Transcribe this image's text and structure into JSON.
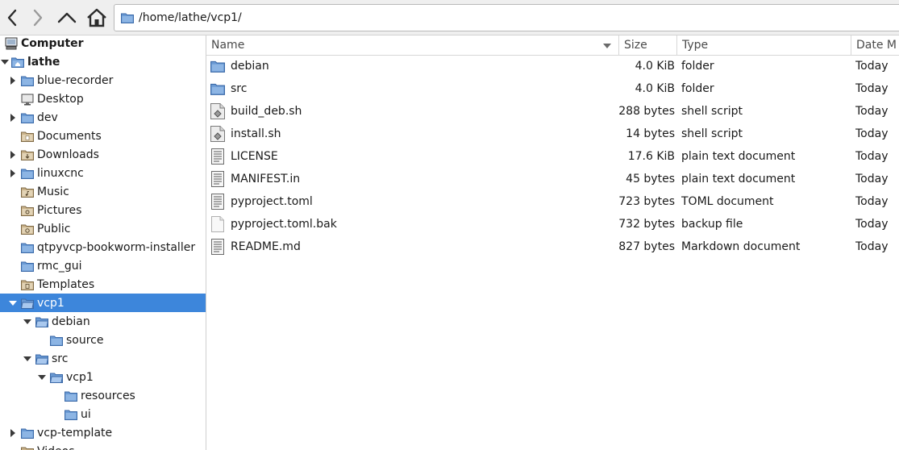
{
  "toolbar": {
    "location": "/home/lathe/vcp1/"
  },
  "sidebar": {
    "items": [
      {
        "label": "Computer",
        "icon": "computer-icon",
        "depth": 0,
        "expander": "none",
        "bold": true
      },
      {
        "label": "lathe",
        "icon": "home-folder-icon",
        "depth": 0,
        "expander": "open",
        "bold": true
      },
      {
        "label": "blue-recorder",
        "icon": "folder-icon",
        "depth": 1,
        "expander": "closed"
      },
      {
        "label": "Desktop",
        "icon": "desktop-icon",
        "depth": 1,
        "expander": "none"
      },
      {
        "label": "dev",
        "icon": "folder-icon",
        "depth": 1,
        "expander": "closed"
      },
      {
        "label": "Documents",
        "icon": "documents-folder-icon",
        "depth": 1,
        "expander": "none"
      },
      {
        "label": "Downloads",
        "icon": "downloads-folder-icon",
        "depth": 1,
        "expander": "closed"
      },
      {
        "label": "linuxcnc",
        "icon": "folder-icon",
        "depth": 1,
        "expander": "closed"
      },
      {
        "label": "Music",
        "icon": "music-folder-icon",
        "depth": 1,
        "expander": "none"
      },
      {
        "label": "Pictures",
        "icon": "pictures-folder-icon",
        "depth": 1,
        "expander": "none"
      },
      {
        "label": "Public",
        "icon": "public-folder-icon",
        "depth": 1,
        "expander": "none"
      },
      {
        "label": "qtpyvcp-bookworm-installer",
        "icon": "folder-icon",
        "depth": 1,
        "expander": "none"
      },
      {
        "label": "rmc_gui",
        "icon": "folder-icon",
        "depth": 1,
        "expander": "none"
      },
      {
        "label": "Templates",
        "icon": "templates-folder-icon",
        "depth": 1,
        "expander": "none"
      },
      {
        "label": "vcp1",
        "icon": "folder-open-icon",
        "depth": 1,
        "expander": "open",
        "selected": true
      },
      {
        "label": "debian",
        "icon": "folder-open-icon",
        "depth": 2,
        "expander": "open"
      },
      {
        "label": "source",
        "icon": "folder-icon",
        "depth": 3,
        "expander": "none"
      },
      {
        "label": "src",
        "icon": "folder-open-icon",
        "depth": 2,
        "expander": "open"
      },
      {
        "label": "vcp1",
        "icon": "folder-open-icon",
        "depth": 3,
        "expander": "open"
      },
      {
        "label": "resources",
        "icon": "folder-icon",
        "depth": 4,
        "expander": "none"
      },
      {
        "label": "ui",
        "icon": "folder-icon",
        "depth": 4,
        "expander": "none"
      },
      {
        "label": "vcp-template",
        "icon": "folder-icon",
        "depth": 1,
        "expander": "closed"
      },
      {
        "label": "Videos",
        "icon": "videos-folder-icon",
        "depth": 1,
        "expander": "none"
      }
    ]
  },
  "columns": {
    "name": "Name",
    "size": "Size",
    "type": "Type",
    "date": "Date M"
  },
  "files": [
    {
      "name": "debian",
      "size": "4.0 KiB",
      "type": "folder",
      "date": "Today",
      "icon": "folder-icon"
    },
    {
      "name": "src",
      "size": "4.0 KiB",
      "type": "folder",
      "date": "Today",
      "icon": "folder-icon"
    },
    {
      "name": "build_deb.sh",
      "size": "288 bytes",
      "type": "shell script",
      "date": "Today",
      "icon": "shell-script-icon"
    },
    {
      "name": "install.sh",
      "size": "14 bytes",
      "type": "shell script",
      "date": "Today",
      "icon": "shell-script-icon"
    },
    {
      "name": "LICENSE",
      "size": "17.6 KiB",
      "type": "plain text document",
      "date": "Today",
      "icon": "text-document-icon"
    },
    {
      "name": "MANIFEST.in",
      "size": "45 bytes",
      "type": "plain text document",
      "date": "Today",
      "icon": "text-document-icon"
    },
    {
      "name": "pyproject.toml",
      "size": "723 bytes",
      "type": "TOML document",
      "date": "Today",
      "icon": "text-document-icon"
    },
    {
      "name": "pyproject.toml.bak",
      "size": "732 bytes",
      "type": "backup file",
      "date": "Today",
      "icon": "blank-file-icon"
    },
    {
      "name": "README.md",
      "size": "827 bytes",
      "type": "Markdown document",
      "date": "Today",
      "icon": "text-document-icon"
    }
  ],
  "colors": {
    "selection": "#3d86db",
    "folder": "#6a9ad4"
  }
}
